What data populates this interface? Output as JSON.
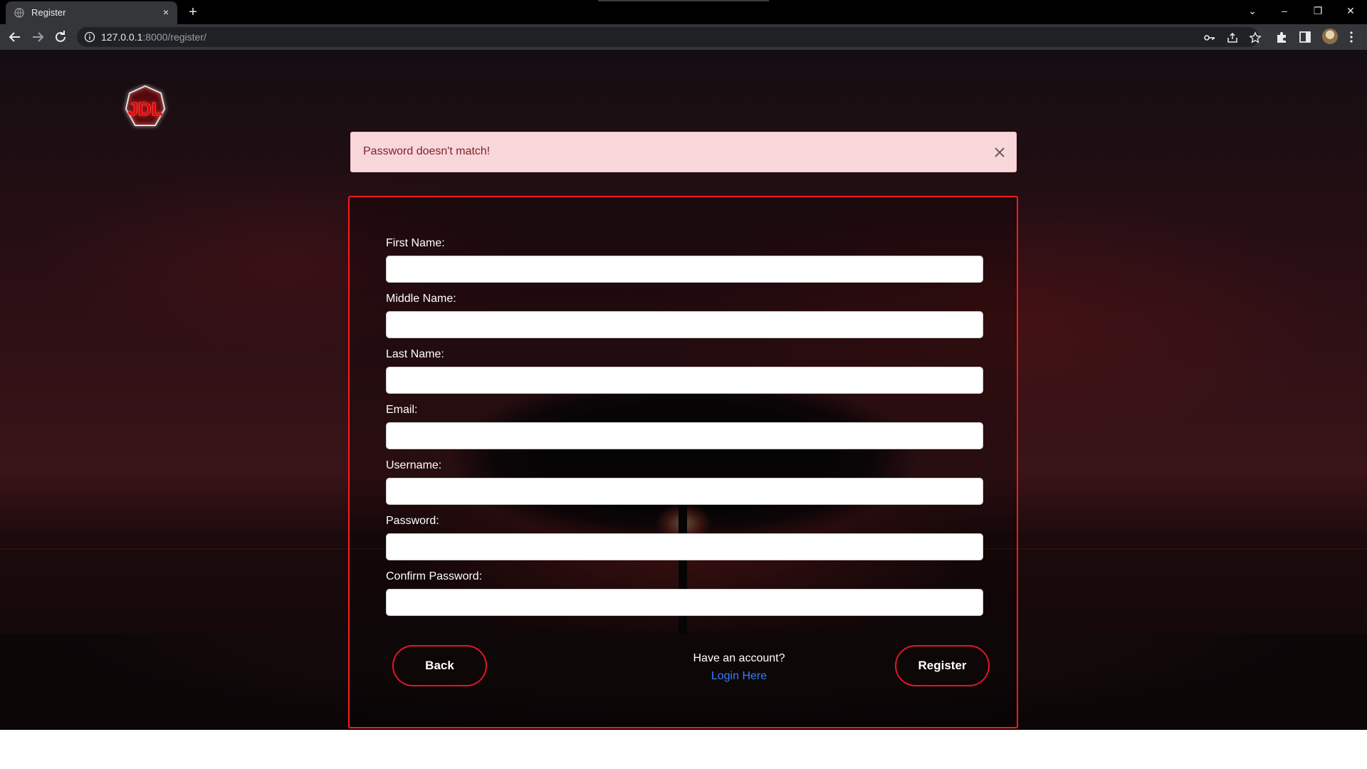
{
  "browser": {
    "tab_title": "Register",
    "tab_close": "×",
    "new_tab": "+",
    "url_host": "127.0.0.1",
    "url_rest": ":8000/register/",
    "window_controls": {
      "minimize": "–",
      "restore": "❐",
      "close": "✕",
      "tab_search": "⌄"
    }
  },
  "alert": {
    "message": "Password doesn't match!"
  },
  "form": {
    "fields": [
      {
        "label": "First Name:",
        "value": ""
      },
      {
        "label": "Middle Name:",
        "value": ""
      },
      {
        "label": "Last Name:",
        "value": ""
      },
      {
        "label": "Email:",
        "value": ""
      },
      {
        "label": "Username:",
        "value": ""
      },
      {
        "label": "Password:",
        "value": ""
      },
      {
        "label": "Confirm Password:",
        "value": ""
      }
    ],
    "back_label": "Back",
    "register_label": "Register",
    "have_account_text": "Have an account?",
    "login_link_text": "Login Here"
  },
  "logo": {
    "text": "JDL"
  },
  "colors": {
    "accent": "#ff1a1a",
    "alert_bg": "#f8d7da",
    "alert_text": "#842029",
    "link": "#2f7fff"
  }
}
